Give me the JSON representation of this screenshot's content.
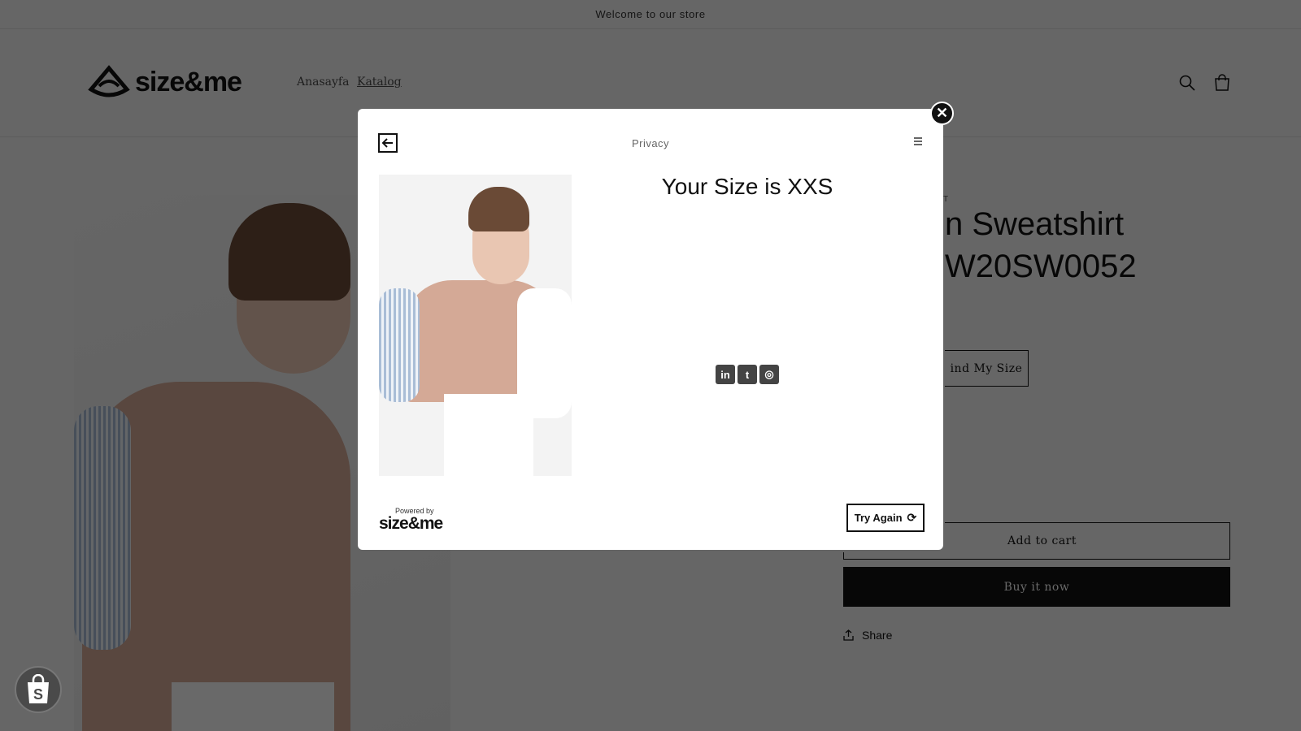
{
  "announcement": "Welcome to our store",
  "header": {
    "logo": "size&me",
    "nav": [
      "Anasayfa",
      "Katalog"
    ]
  },
  "product": {
    "vendor_fragment": "T",
    "title_line1": "n Sweatshirt",
    "title_line2": "W20SW0052",
    "find_size": "ind My Size",
    "add_to_cart": "Add to cart",
    "buy_now": "Buy it now",
    "share": "Share"
  },
  "modal": {
    "header": "Privacy",
    "result": "Your Size is XXS",
    "social": [
      "linkedin",
      "twitter",
      "instagram"
    ],
    "powered_by": "Powered by",
    "powered_logo": "size&me",
    "try_again": "Try Again"
  },
  "colors": {
    "overlay": "#666666",
    "button": "#121212"
  }
}
